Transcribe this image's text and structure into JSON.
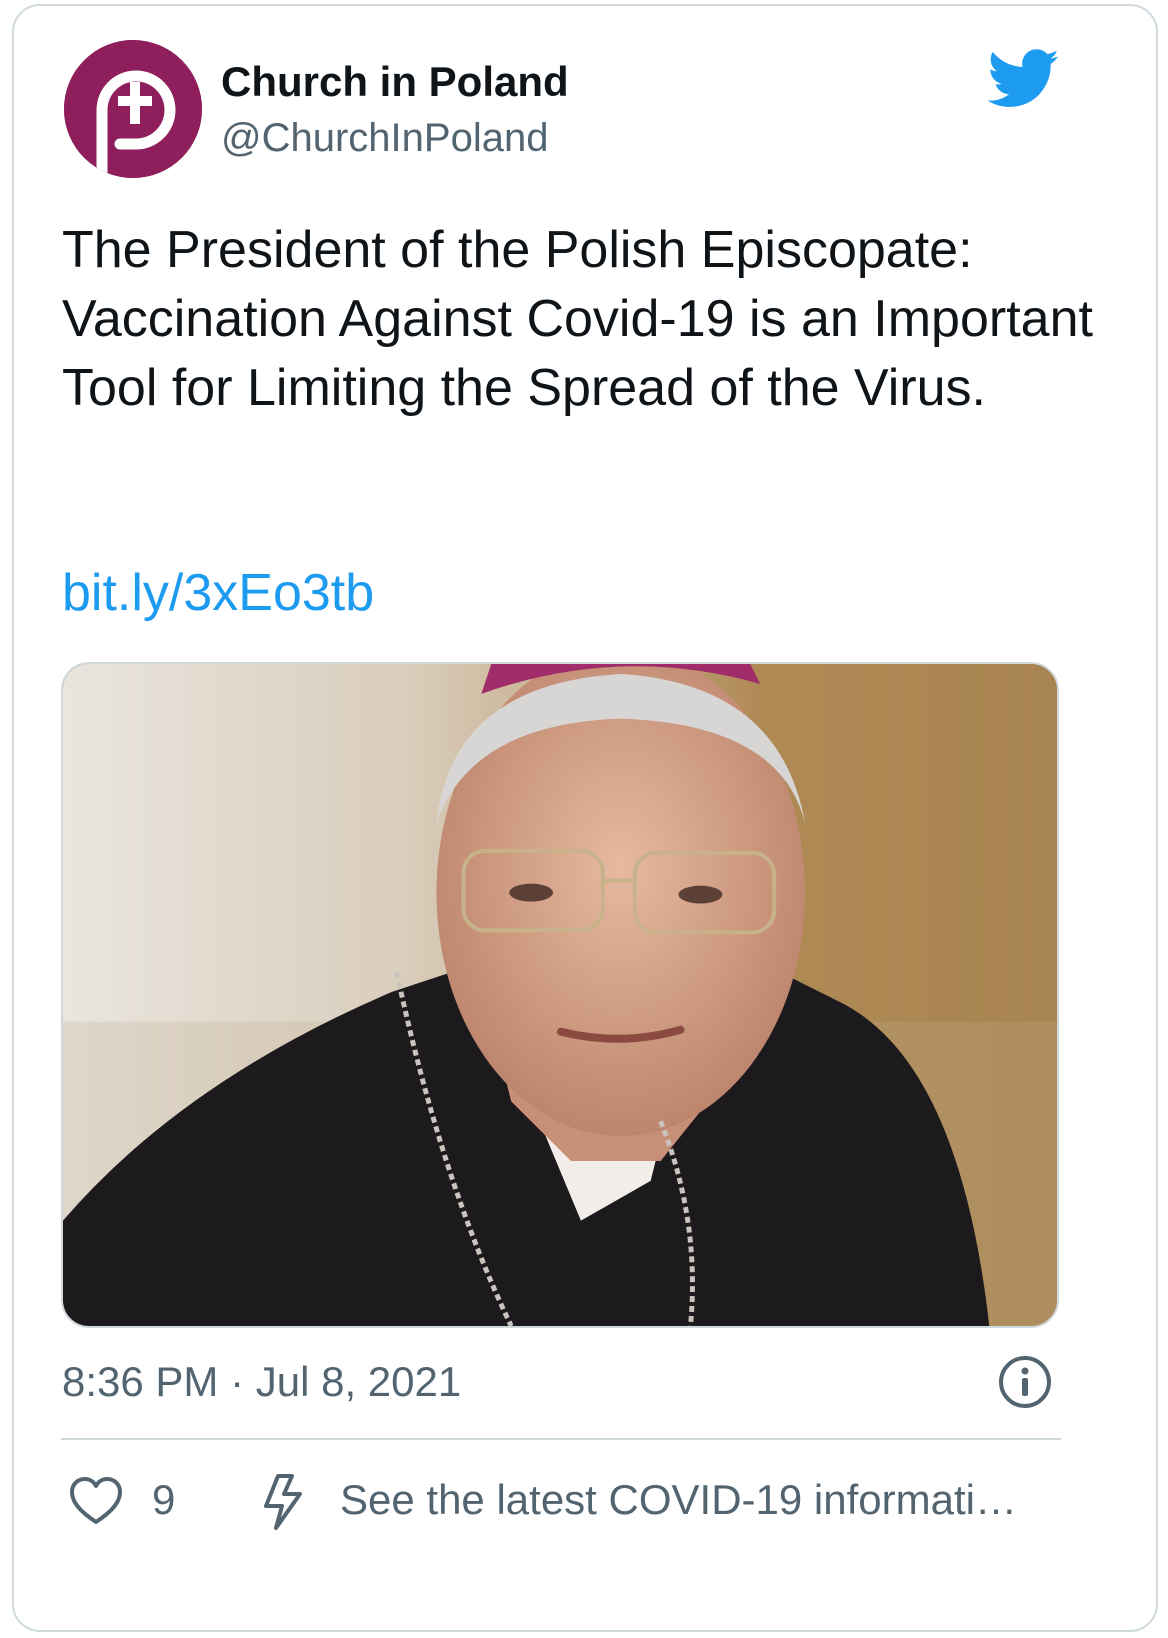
{
  "author": {
    "name": "Church in Poland",
    "handle": "@ChurchInPoland",
    "avatar_color": "#8e1f5c"
  },
  "tweet": {
    "text": "The President of the Polish Episcopate: Vaccination Against Covid-19 is an Important Tool for Limiting the Spread of the Virus.",
    "link": "bit.ly/3xEo3tb",
    "timestamp": "8:36 PM · Jul 8, 2021"
  },
  "actions": {
    "like_count": "9",
    "covid_info": "See the latest COVID-19 informati…"
  },
  "icons": {
    "brand": "twitter-bird-icon",
    "info": "info-icon",
    "like": "heart-icon",
    "covid": "lightning-icon"
  },
  "colors": {
    "link": "#1d9bf0",
    "secondary_text": "#536471",
    "border": "#cfd9de",
    "brand_blue": "#1d9bf0"
  }
}
